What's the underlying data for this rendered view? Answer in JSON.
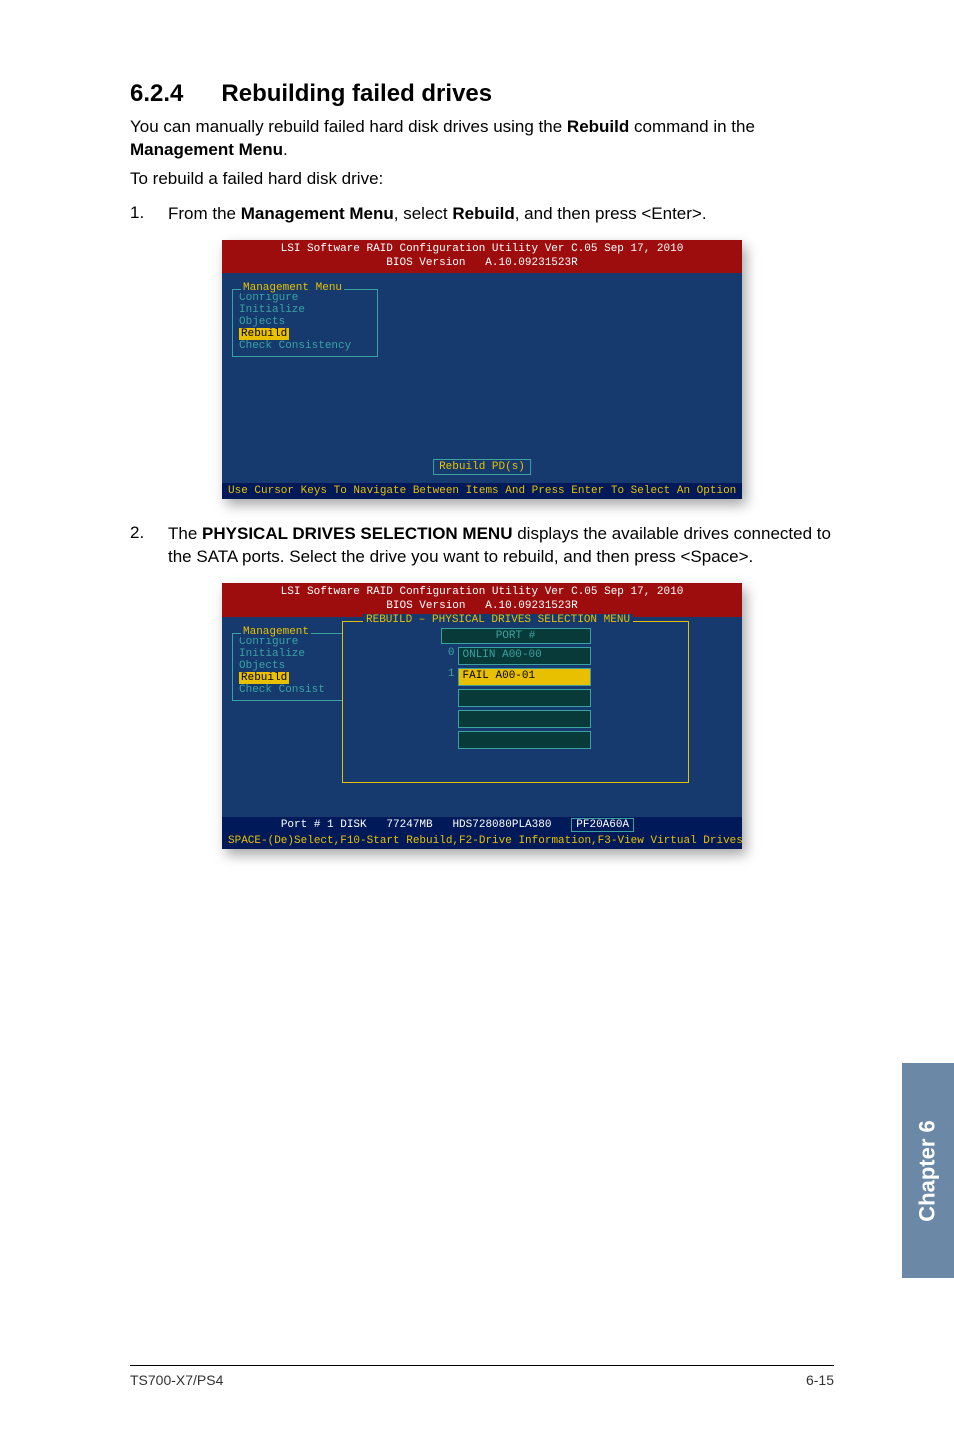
{
  "section": {
    "number": "6.2.4",
    "title": "Rebuilding failed drives"
  },
  "intro_a": "You can manually rebuild failed hard disk drives using the ",
  "intro_bold1": "Rebuild",
  "intro_b": " command in the ",
  "intro_bold2": "Management Menu",
  "intro_c": ".",
  "line2": "To rebuild a failed hard disk drive:",
  "step1_n": "1.",
  "step1_a": "From the ",
  "step1_b1": "Management Menu",
  "step1_b": ", select ",
  "step1_b2": "Rebuild",
  "step1_c": ", and then press <Enter>.",
  "bios_header_l1": "LSI Software RAID Configuration Utility Ver C.05 Sep 17, 2010",
  "bios_header_l2": "BIOS Version   A.10.09231523R",
  "mgmt_legend": "Management Menu",
  "mgmt_items": [
    "Configure",
    "Initialize",
    "Objects",
    "Rebuild",
    "Check Consistency"
  ],
  "rebuild_badge": "Rebuild PD(s)",
  "bios1_footer": "Use Cursor Keys To Navigate Between Items And Press Enter To Select An Option",
  "step2_n": "2.",
  "step2_a": "The ",
  "step2_b1": "PHYSICAL DRIVES SELECTION MENU",
  "step2_b": " displays the available drives connected to the SATA ports. Select the drive you want to rebuild, and then press <Space>.",
  "mgmt2_items": [
    "Configure",
    "Initialize",
    "Objects",
    "Rebuild",
    "Check Consist"
  ],
  "mgmt2_legend": "Management",
  "rebuild_legend": "REBUILD – PHYSICAL DRIVES SELECTION MENU",
  "port_head": "PORT #",
  "drives": [
    {
      "idx": "0",
      "label": "ONLIN A00-00",
      "selected": false
    },
    {
      "idx": "1",
      "label": "FAIL  A00-01",
      "selected": true
    }
  ],
  "empty_rows": 3,
  "port_strip_a": "Port # 1 DISK   77247MB   HDS728080PLA380   ",
  "port_strip_pf": "PF20A60A",
  "bios2_footer": "SPACE-(De)Select,F10-Start Rebuild,F2-Drive Information,F3-View Virtual Drives",
  "sidetab": "Chapter 6",
  "footer_left": "TS700-X7/PS4",
  "footer_right": "6-15"
}
